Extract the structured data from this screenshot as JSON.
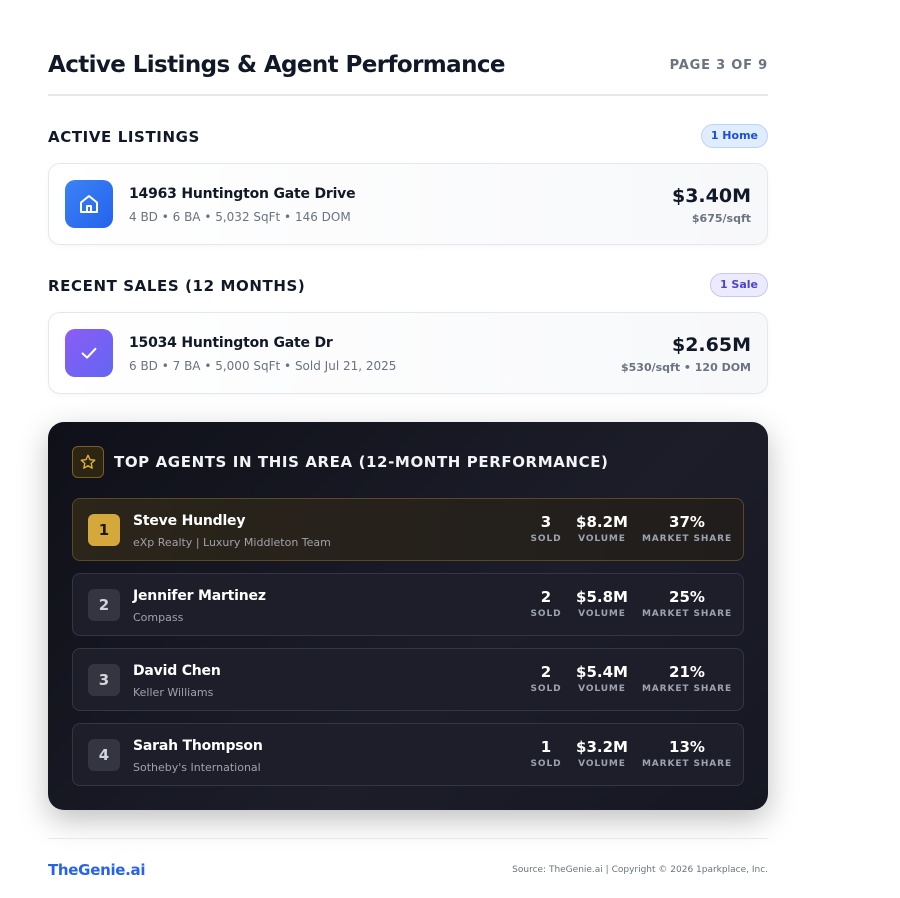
{
  "header": {
    "title": "Active Listings & Agent Performance",
    "page_indicator": "PAGE 3 OF 9"
  },
  "active_listings": {
    "title": "ACTIVE LISTINGS",
    "count_badge": "1 Home",
    "icon": "home-icon",
    "items": [
      {
        "address": "14963 Huntington Gate Drive",
        "details": "4 BD • 6 BA • 5,032 SqFt • 146 DOM",
        "price": "$3.40M",
        "sub": "$675/sqft"
      }
    ]
  },
  "recent_sales": {
    "title": "RECENT SALES (12 MONTHS)",
    "count_badge": "1 Sale",
    "icon": "checkmark-icon",
    "items": [
      {
        "address": "15034 Huntington Gate Dr",
        "details": "6 BD • 7 BA • 5,000 SqFt • Sold Jul 21, 2025",
        "price": "$2.65M",
        "sub": "$530/sqft • 120 DOM"
      }
    ]
  },
  "top_agents": {
    "title": "TOP AGENTS IN THIS AREA (12-MONTH PERFORMANCE)",
    "icon": "star-icon",
    "stat_labels": {
      "sold": "SOLD",
      "volume": "VOLUME",
      "share": "MARKET SHARE"
    },
    "agents": [
      {
        "rank": "1",
        "name": "Steve Hundley",
        "brokerage": "eXp Realty | Luxury Middleton Team",
        "sold": "3",
        "volume": "$8.2M",
        "share": "37%"
      },
      {
        "rank": "2",
        "name": "Jennifer Martinez",
        "brokerage": "Compass",
        "sold": "2",
        "volume": "$5.8M",
        "share": "25%"
      },
      {
        "rank": "3",
        "name": "David Chen",
        "brokerage": "Keller Williams",
        "sold": "2",
        "volume": "$5.4M",
        "share": "21%"
      },
      {
        "rank": "4",
        "name": "Sarah Thompson",
        "brokerage": "Sotheby's International",
        "sold": "1",
        "volume": "$3.2M",
        "share": "13%"
      }
    ]
  },
  "footer": {
    "brand": "TheGenie.ai",
    "source": "Source: TheGenie.ai | Copyright © 2026 1parkplace, Inc."
  },
  "colors": {
    "accent_blue": "#2563eb",
    "accent_purple": "#6366f1",
    "gold": "#d4a83a",
    "dark_panel": "#14151f"
  }
}
